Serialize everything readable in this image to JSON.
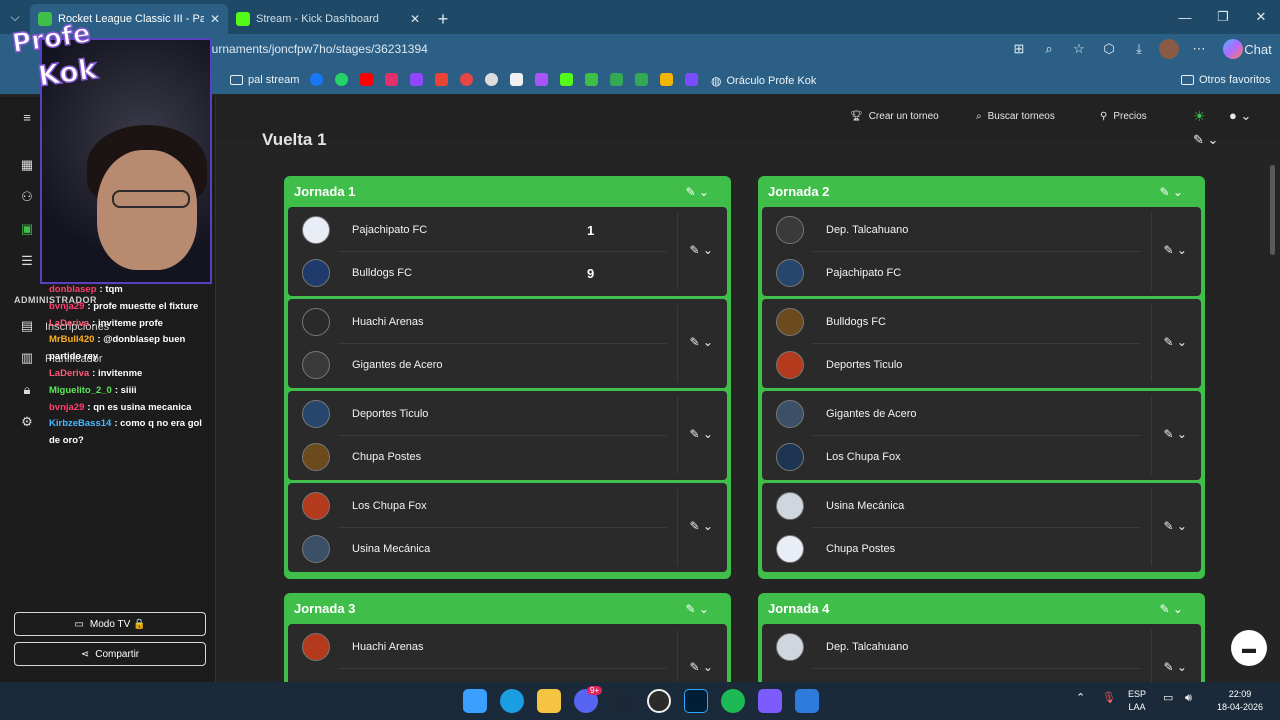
{
  "browser": {
    "tabs": [
      {
        "title": "Rocket League Classic III - Partidos",
        "active": true
      },
      {
        "title": "Stream - Kick Dashboard",
        "active": false
      }
    ],
    "url": "ournaments/joncfpw7ho/stages/36231394",
    "chat_label": "Chat",
    "bookmarks": {
      "folder": "pal stream",
      "oraculo": "Oráculo Profe Kok",
      "others": "Otros favoritos"
    }
  },
  "topnav": {
    "create": "Crear un torneo",
    "search": "Buscar torneos",
    "prices": "Precios"
  },
  "sidebar": {
    "admin_label": "ADMINISTRADOR",
    "inscriptions": "Inscripciones",
    "planner": "Planificador",
    "tv_mode": "Modo TV 🔒",
    "share": "Compartir"
  },
  "overlay": {
    "logo_line1": "Profe",
    "logo_line2": "Kok",
    "chat": [
      {
        "user": "donblasep",
        "msg": "tqm",
        "color": "#ff3d6e"
      },
      {
        "user": "bvnja29",
        "msg": "profe muestte el fixture",
        "color": "#ff3d6e"
      },
      {
        "user": "LaDeriva",
        "msg": "inviteme profe",
        "color": "#ff5a7a"
      },
      {
        "user": "MrBull420",
        "msg": "@donblasep buen partido rey",
        "color": "#ffb020"
      },
      {
        "user": "LaDeriva",
        "msg": "invitenme",
        "color": "#ff5a7a"
      },
      {
        "user": "Miguelito_2_0",
        "msg": "siiii",
        "color": "#5ce65c"
      },
      {
        "user": "bvnja29",
        "msg": "qn es usina mecanica",
        "color": "#ff3d6e"
      },
      {
        "user": "KirbzeBass14",
        "msg": "como q no era gol de oro?",
        "color": "#49b8ff"
      }
    ]
  },
  "page": {
    "round_title": "Vuelta 1"
  },
  "jornadas": [
    {
      "title": "Jornada 1",
      "matches": [
        {
          "home": "Pajachipato FC",
          "away": "Bulldogs FC",
          "home_score": "1",
          "away_score": "9"
        },
        {
          "home": "Huachi Arenas",
          "away": "Gigantes de Acero",
          "home_score": "",
          "away_score": ""
        },
        {
          "home": "Deportes Ticulo",
          "away": "Chupa Postes",
          "home_score": "",
          "away_score": ""
        },
        {
          "home": "Los Chupa Fox",
          "away": "Usina Mecánica",
          "home_score": "",
          "away_score": ""
        }
      ]
    },
    {
      "title": "Jornada 2",
      "matches": [
        {
          "home": "Dep. Talcahuano",
          "away": "Pajachipato FC",
          "home_score": "",
          "away_score": ""
        },
        {
          "home": "Bulldogs FC",
          "away": "Deportes Ticulo",
          "home_score": "",
          "away_score": ""
        },
        {
          "home": "Gigantes de Acero",
          "away": "Los Chupa Fox",
          "home_score": "",
          "away_score": ""
        },
        {
          "home": "Usina Mecánica",
          "away": "Chupa Postes",
          "home_score": "",
          "away_score": ""
        }
      ]
    },
    {
      "title": "Jornada 3",
      "matches": [
        {
          "home": "Huachi Arenas",
          "away": "",
          "home_score": "",
          "away_score": ""
        }
      ]
    },
    {
      "title": "Jornada 4",
      "matches": [
        {
          "home": "Dep. Talcahuano",
          "away": "",
          "home_score": "",
          "away_score": ""
        }
      ]
    }
  ],
  "taskbar": {
    "lang1": "ESP",
    "lang2": "LAA",
    "time": "22:09",
    "date": "18-04-2026",
    "discord_badge": "9+"
  },
  "colors": {
    "accent_green": "#3fbf4a",
    "browser_blue": "#2b5f85"
  }
}
